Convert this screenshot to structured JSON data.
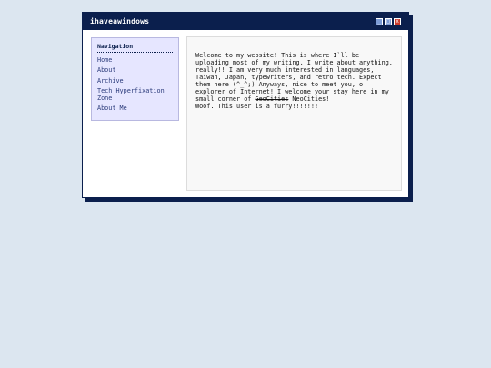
{
  "window": {
    "title": "ihaveawindows",
    "controls": {
      "minimize": "_",
      "maximize": "□",
      "close": "x"
    }
  },
  "sidebar": {
    "heading": "Navigation",
    "items": [
      {
        "label": "Home"
      },
      {
        "label": "About"
      },
      {
        "label": "Archive"
      },
      {
        "label": "Tech Hyperfixation Zone"
      },
      {
        "label": "About Me"
      }
    ]
  },
  "main": {
    "intro_before_strike": "Welcome to my website! This is where I`ll be uploading most of my writing. I write about anything, really!! I am very much interested in languages, Taiwan, Japan, typewriters, and retro tech. Expect them here (^_^;) Anyways, nice to meet you, o explorer of Internet! I welcome your stay here in my small corner of ",
    "strike_text": "GeoCities",
    "intro_after_strike": " NeoCities!",
    "furry_line": "Woof. This user is a furry!!!!!!!"
  },
  "colors": {
    "page_bg": "#dce6f0",
    "window_border": "#0b1f4d",
    "titlebar": "#0b1f4d",
    "sidebar_bg": "#e6e6ff",
    "link": "#2a3a7a",
    "close_button": "#cc3b2c",
    "control_button": "#7d9cd6"
  }
}
